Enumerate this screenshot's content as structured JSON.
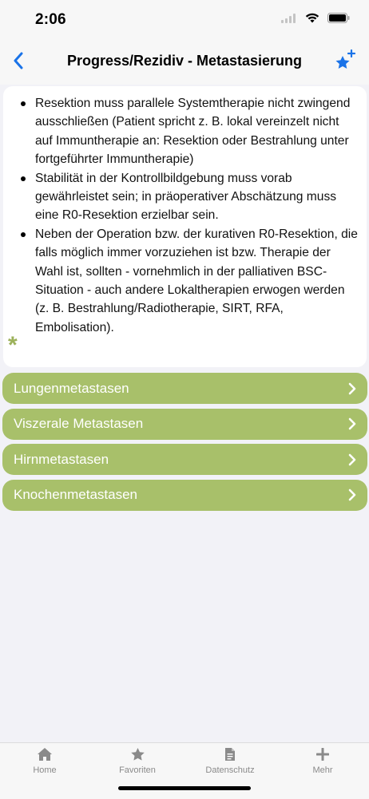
{
  "status": {
    "time": "2:06"
  },
  "nav": {
    "title": "Progress/Rezidiv - Metastasierung",
    "accent": "#1a73e8"
  },
  "content": {
    "bullets": [
      "Resektion muss parallele Systemtherapie nicht zwingend ausschließen (Patient spricht z. B. lokal vereinzelt nicht auf Immuntherapie an: Resektion oder Bestrahlung unter fortgeführter Immuntherapie)",
      "Stabilität in der Kontrollbildgebung muss vorab gewährleistet sein; in präoperativer Abschätzung muss eine R0-Resektion erzielbar sein.",
      "Neben der Operation bzw. der kurativen R0-Resektion, die falls möglich immer vorzuziehen ist bzw. Therapie der Wahl ist, sollten - vornehmlich in der palliativen BSC-Situation - auch andere Lokaltherapien erwogen werden (z. B. Bestrahlung/Radiotherapie, SIRT, RFA, Embolisation)."
    ],
    "asterisk": "*"
  },
  "menu": {
    "color": "#a8c06a",
    "items": [
      {
        "label": "Lungenmetastasen"
      },
      {
        "label": "Viszerale Metastasen"
      },
      {
        "label": "Hirnmetastasen"
      },
      {
        "label": "Knochenmetastasen"
      }
    ]
  },
  "tabbar": {
    "tabs": [
      {
        "label": "Home",
        "icon": "home-icon"
      },
      {
        "label": "Favoriten",
        "icon": "star-icon"
      },
      {
        "label": "Datenschutz",
        "icon": "document-icon"
      },
      {
        "label": "Mehr",
        "icon": "plus-icon"
      }
    ]
  }
}
